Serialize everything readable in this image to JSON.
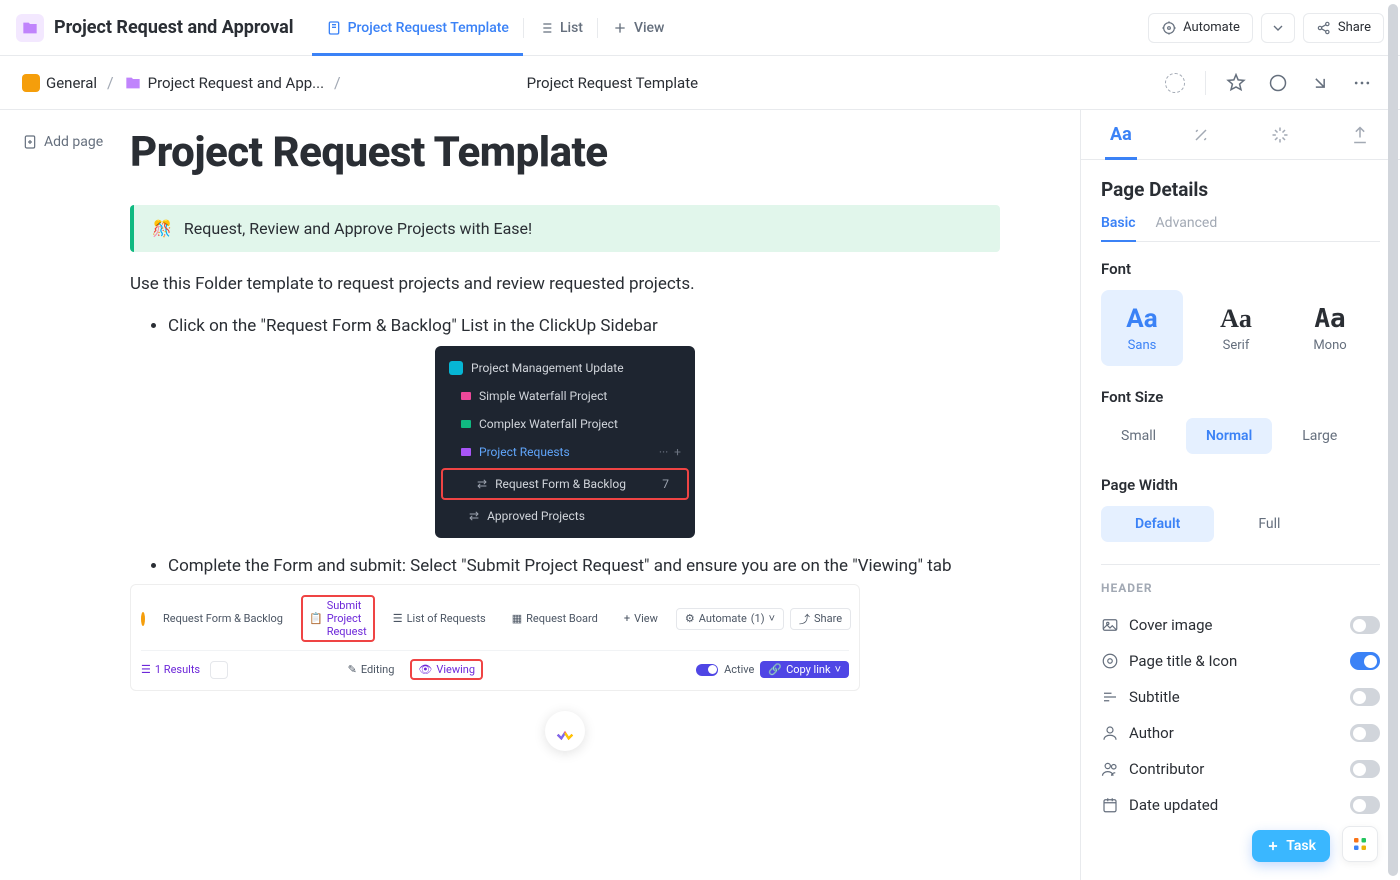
{
  "topbar": {
    "title": "Project Request and Approval",
    "tabs": {
      "template": "Project Request Template",
      "list": "List",
      "view": "View"
    },
    "automate": "Automate",
    "share": "Share"
  },
  "breadcrumb": {
    "general": "General",
    "folder": "Project Request and App...",
    "page": "Project Request Template"
  },
  "add_page": "Add page",
  "doc": {
    "title": "Project Request Template",
    "callout": "Request, Review and Approve Projects with Ease!",
    "lead": "Use this Folder template to request projects and review requested projects.",
    "li1": "Click on the \"Request Form & Backlog\" List in the ClickUp Sidebar",
    "li2": "Complete the Form and submit: Select \"Submit Project Request\" and ensure you are on the \"Viewing\" tab"
  },
  "shot1": {
    "r1": "Project Management Update",
    "r2": "Simple Waterfall Project",
    "r3": "Complex Waterfall Project",
    "r4": "Project Requests",
    "r5": "Request Form & Backlog",
    "r5count": "7",
    "r6": "Approved Projects"
  },
  "shot2": {
    "backlog": "Request Form & Backlog",
    "submit": "Submit Project Request",
    "listreq": "List of Requests",
    "board": "Request Board",
    "view": "View",
    "automate": "Automate",
    "autocount": "(1)",
    "share": "Share",
    "results": "1 Results",
    "editing": "Editing",
    "viewing": "Viewing",
    "active": "Active",
    "copy": "Copy link"
  },
  "sidebar": {
    "heading": "Page Details",
    "tabs": {
      "basic": "Basic",
      "advanced": "Advanced"
    },
    "font": {
      "label": "Font",
      "sans": "Sans",
      "serif": "Serif",
      "mono": "Mono"
    },
    "fontsize": {
      "label": "Font Size",
      "small": "Small",
      "normal": "Normal",
      "large": "Large"
    },
    "pagewidth": {
      "label": "Page Width",
      "default": "Default",
      "full": "Full"
    },
    "header": {
      "label": "HEADER",
      "cover": "Cover image",
      "title": "Page title & Icon",
      "subtitle": "Subtitle",
      "author": "Author",
      "contributor": "Contributor",
      "date": "Date updated"
    }
  },
  "task_btn": "Task"
}
